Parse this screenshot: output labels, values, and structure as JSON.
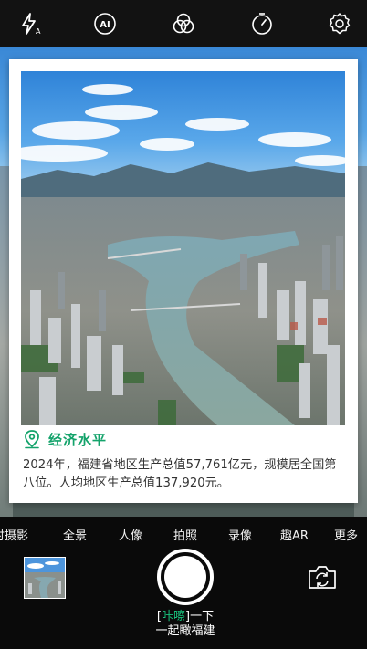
{
  "toolbar": {
    "icons": [
      "flash-auto-icon",
      "ai-icon",
      "filter-icon",
      "timer-icon",
      "settings-icon"
    ],
    "ai_label": "AI"
  },
  "card": {
    "title": "经济水平",
    "description": "2024年，福建省地区生产总值57,761亿元，规模居全国第八位。人均地区生产总值137,920元。"
  },
  "modes": {
    "items": [
      "时摄影",
      "全景",
      "人像",
      "拍照",
      "录像",
      "趣AR",
      "更多"
    ]
  },
  "promo": {
    "line1_open": "[",
    "line1_kacha": "咔嚓",
    "line1_close": "]一下",
    "line2": "一起瞰福建"
  },
  "colors": {
    "accent": "#14a36b",
    "promo_accent": "#19c37d",
    "toolbar_bg": "#121212",
    "controls_bg": "#0a0a0a"
  }
}
